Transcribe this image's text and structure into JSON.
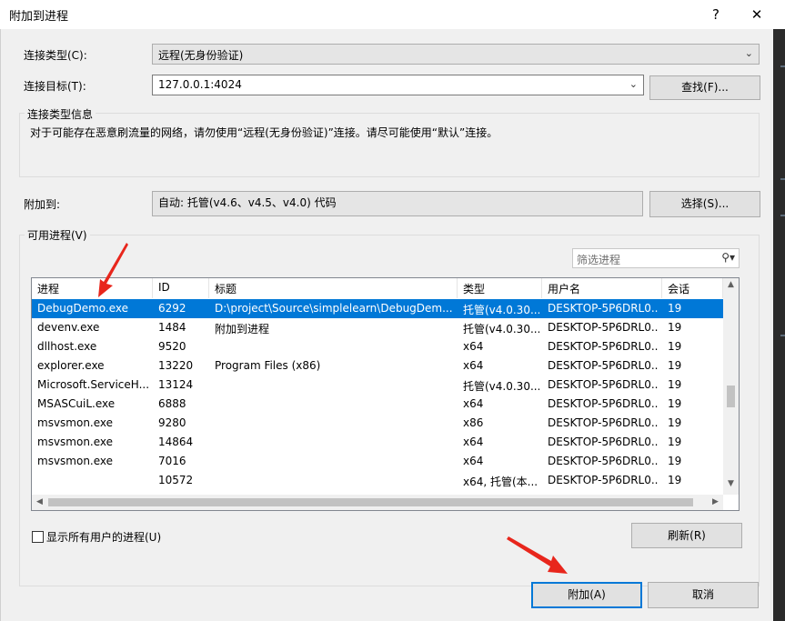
{
  "window": {
    "title": "附加到进程",
    "help_glyph": "?",
    "close_glyph": "✕"
  },
  "connection": {
    "type_label": "连接类型(C):",
    "type_value": "远程(无身份验证)",
    "target_label": "连接目标(T):",
    "target_value": "127.0.0.1:4024",
    "find_button": "查找(F)...",
    "info_group_title": "连接类型信息",
    "info_text": "对于可能存在恶意刷流量的网络，请勿使用“远程(无身份验证)”连接。请尽可能使用“默认”连接。"
  },
  "attach_to": {
    "label": "附加到:",
    "value": "自动: 托管(v4.6、v4.5、v4.0) 代码",
    "select_button": "选择(S)..."
  },
  "processes": {
    "group_title": "可用进程(V)",
    "filter_placeholder": "筛选进程",
    "columns": [
      "进程",
      "ID",
      "标题",
      "类型",
      "用户名",
      "会话"
    ],
    "rows": [
      {
        "name": "DebugDemo.exe",
        "id": "6292",
        "title": "D:\\project\\Source\\simplelearn\\DebugDem...",
        "type": "托管(v4.0.30...",
        "user": "DESKTOP-5P6DRL0...",
        "session": "19"
      },
      {
        "name": "devenv.exe",
        "id": "1484",
        "title": "附加到进程",
        "type": "托管(v4.0.30...",
        "user": "DESKTOP-5P6DRL0...",
        "session": "19"
      },
      {
        "name": "dllhost.exe",
        "id": "9520",
        "title": "",
        "type": "x64",
        "user": "DESKTOP-5P6DRL0...",
        "session": "19"
      },
      {
        "name": "explorer.exe",
        "id": "13220",
        "title": "Program Files (x86)",
        "type": "x64",
        "user": "DESKTOP-5P6DRL0...",
        "session": "19"
      },
      {
        "name": "Microsoft.ServiceH...",
        "id": "13124",
        "title": "",
        "type": "托管(v4.0.30...",
        "user": "DESKTOP-5P6DRL0...",
        "session": "19"
      },
      {
        "name": "MSASCuiL.exe",
        "id": "6888",
        "title": "",
        "type": "x64",
        "user": "DESKTOP-5P6DRL0...",
        "session": "19"
      },
      {
        "name": "msvsmon.exe",
        "id": "9280",
        "title": "",
        "type": "x86",
        "user": "DESKTOP-5P6DRL0...",
        "session": "19"
      },
      {
        "name": "msvsmon.exe",
        "id": "14864",
        "title": "",
        "type": "x64",
        "user": "DESKTOP-5P6DRL0...",
        "session": "19"
      },
      {
        "name": "msvsmon.exe",
        "id": "7016",
        "title": "",
        "type": "x64",
        "user": "DESKTOP-5P6DRL0...",
        "session": "19"
      },
      {
        "name": "",
        "id": "10572",
        "title": "",
        "type": "x64, 托管(本...",
        "user": "DESKTOP-5P6DRL0...",
        "session": "19"
      }
    ],
    "show_all_users_label": "显示所有用户的进程(U)",
    "refresh_button": "刷新(R)"
  },
  "footer": {
    "attach_button": "附加(A)",
    "cancel_button": "取消"
  },
  "colors": {
    "selection": "#0078d7",
    "annotation_arrow": "#e8261c"
  }
}
